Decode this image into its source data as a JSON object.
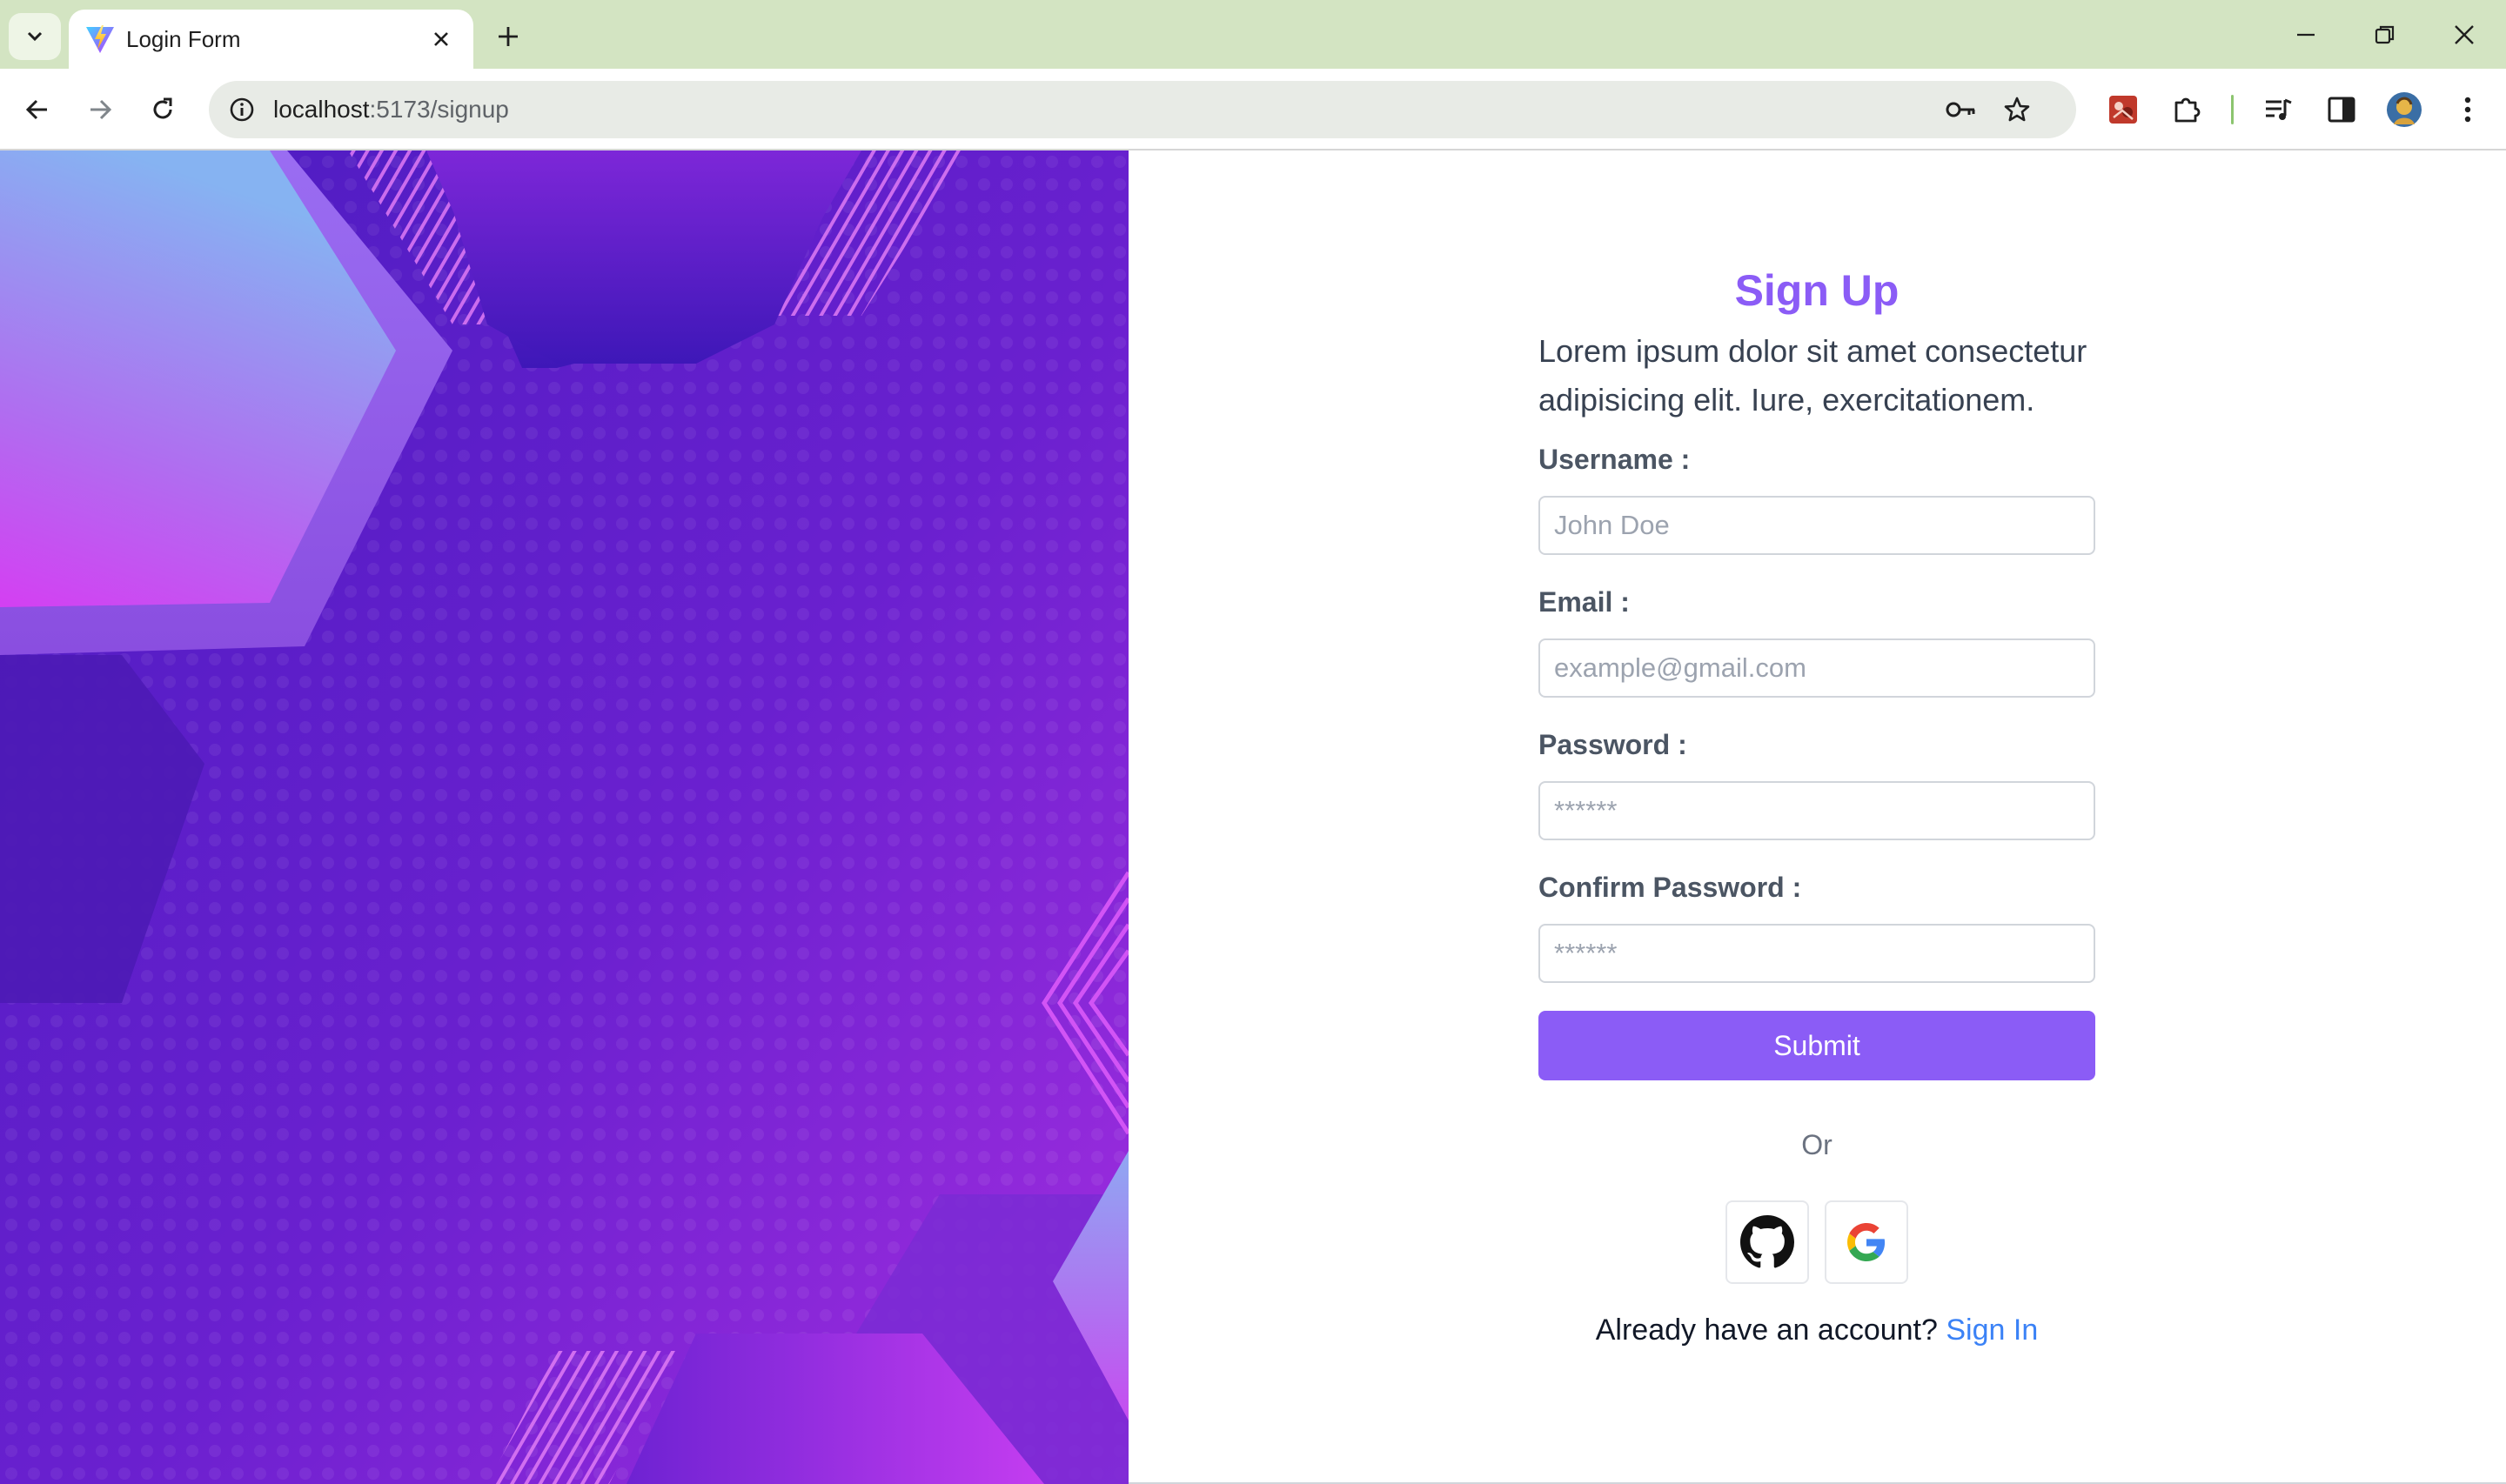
{
  "browser": {
    "tab": {
      "title": "Login Form",
      "favicon": "vite-logo-icon"
    },
    "address_bar": {
      "host": "localhost",
      "path": ":5173/signup"
    },
    "icons": {
      "tab_search": "chevron-down-icon",
      "close_tab": "close-icon",
      "new_tab": "plus-icon",
      "minimize": "minimize-icon",
      "restore": "restore-icon",
      "close_window": "close-icon",
      "back": "back-arrow-icon",
      "forward": "forward-arrow-icon",
      "reload": "reload-icon",
      "site_info": "info-icon",
      "password_manager": "key-icon",
      "bookmark": "star-icon",
      "extension_app": "extension-app-icon",
      "extensions": "puzzle-icon",
      "media_controls": "media-queue-icon",
      "side_panel": "side-panel-icon",
      "profile": "avatar",
      "menu": "more-vert-icon"
    }
  },
  "form": {
    "title": "Sign Up",
    "description": "Lorem ipsum dolor sit amet consectetur adipisicing elit. Iure, exercitationem.",
    "fields": [
      {
        "label": "Username :",
        "placeholder": "John Doe",
        "type": "text"
      },
      {
        "label": "Email :",
        "placeholder": "example@gmail.com",
        "type": "email"
      },
      {
        "label": "Password :",
        "placeholder": "******",
        "type": "password"
      },
      {
        "label": "Confirm Password :",
        "placeholder": "******",
        "type": "password"
      }
    ],
    "submit_label": "Submit",
    "or_label": "Or",
    "social": [
      {
        "provider": "github",
        "icon": "github-icon"
      },
      {
        "provider": "google",
        "icon": "google-icon"
      }
    ],
    "signin_prompt": "Already have an account?",
    "signin_link": "Sign In"
  },
  "colors": {
    "accent": "#8b5cf6",
    "link": "#3b82f6",
    "tabstrip": "#d3e4c2",
    "hero_dark": "#5b1fc4",
    "hero_light": "#c13ef0"
  }
}
